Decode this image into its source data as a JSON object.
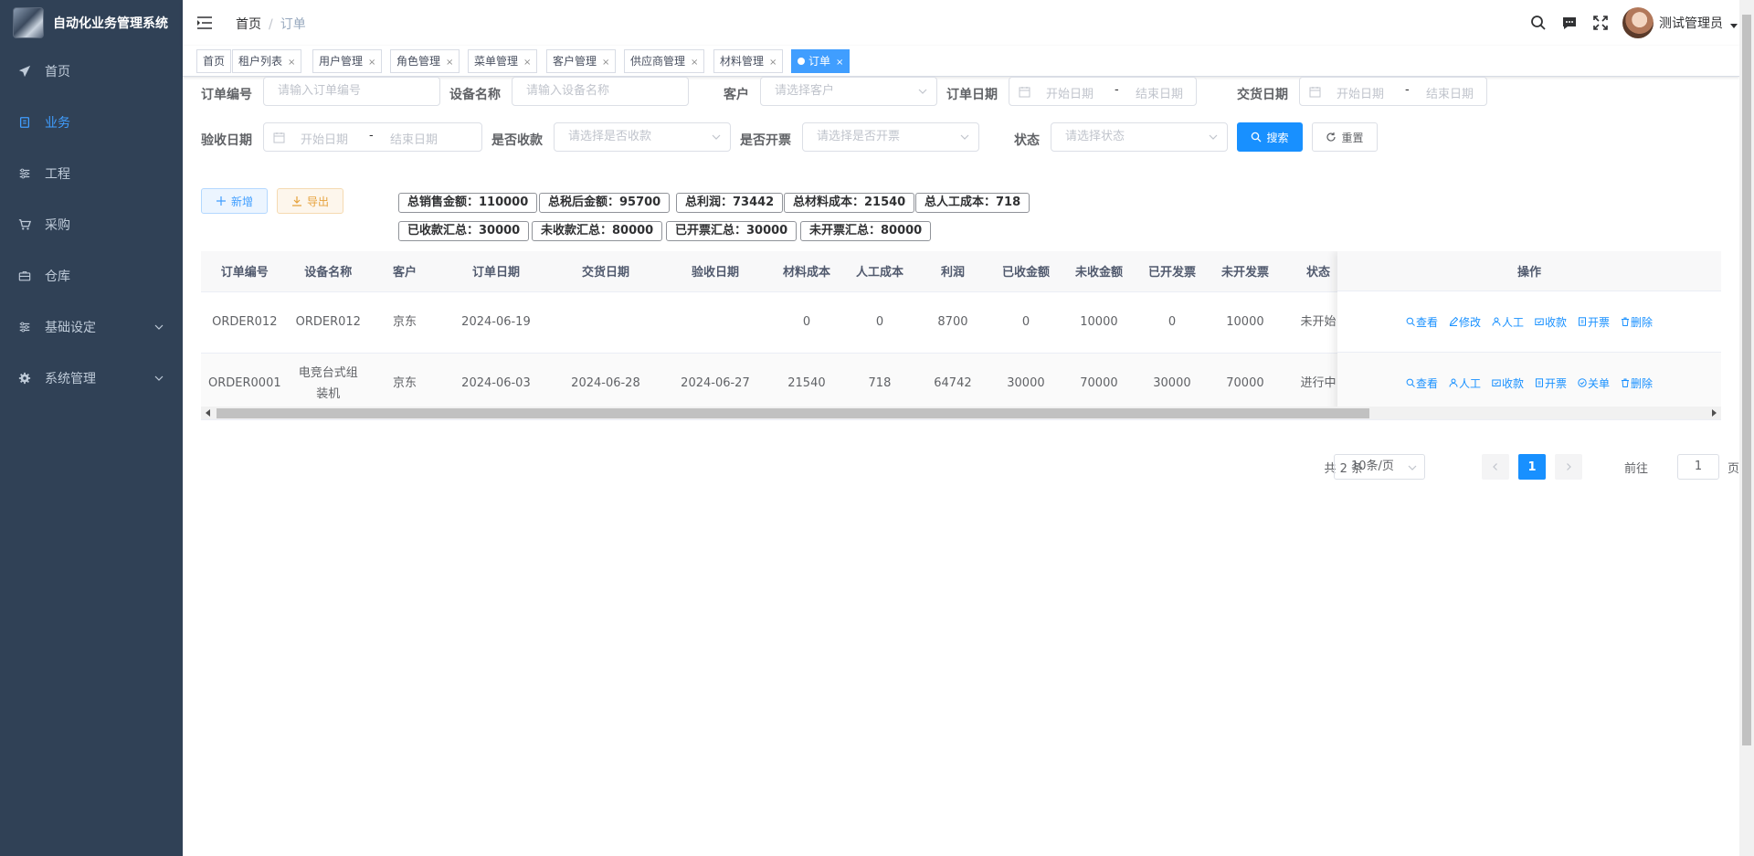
{
  "app": {
    "title": "自动化业务管理系统"
  },
  "sidebar": {
    "items": [
      {
        "label": "首页",
        "icon": "send-icon",
        "active": false
      },
      {
        "label": "业务",
        "icon": "document-icon",
        "active": true
      },
      {
        "label": "工程",
        "icon": "sliders-icon",
        "active": false
      },
      {
        "label": "采购",
        "icon": "cart-icon",
        "active": false
      },
      {
        "label": "仓库",
        "icon": "briefcase-icon",
        "active": false
      },
      {
        "label": "基础设定",
        "icon": "sliders-icon",
        "active": false,
        "expandable": true
      },
      {
        "label": "系统管理",
        "icon": "gear-icon",
        "active": false,
        "expandable": true
      }
    ]
  },
  "header": {
    "breadcrumb": {
      "home": "首页",
      "separator": "/",
      "current": "订单"
    },
    "user_name": "测试管理员"
  },
  "tabs": [
    {
      "label": "首页",
      "closable": false
    },
    {
      "label": "租户列表",
      "closable": true
    },
    {
      "label": "用户管理",
      "closable": true
    },
    {
      "label": "角色管理",
      "closable": true
    },
    {
      "label": "菜单管理",
      "closable": true
    },
    {
      "label": "客户管理",
      "closable": true
    },
    {
      "label": "供应商管理",
      "closable": true
    },
    {
      "label": "材料管理",
      "closable": true
    },
    {
      "label": "订单",
      "closable": true,
      "active": true
    }
  ],
  "filters": {
    "order_no": {
      "label": "订单编号",
      "placeholder": "请输入订单编号"
    },
    "device_name": {
      "label": "设备名称",
      "placeholder": "请输入设备名称"
    },
    "customer": {
      "label": "客户",
      "placeholder": "请选择客户"
    },
    "order_date": {
      "label": "订单日期",
      "start": "开始日期",
      "separator": "-",
      "end": "结束日期"
    },
    "delivery_date": {
      "label": "交货日期",
      "start": "开始日期",
      "separator": "-",
      "end": "结束日期"
    },
    "accept_date": {
      "label": "验收日期",
      "start": "开始日期",
      "separator": "-",
      "end": "结束日期"
    },
    "collected": {
      "label": "是否收款",
      "placeholder": "请选择是否收款"
    },
    "invoiced": {
      "label": "是否开票",
      "placeholder": "请选择是否开票"
    },
    "status": {
      "label": "状态",
      "placeholder": "请选择状态"
    },
    "search_label": "搜索",
    "reset_label": "重置"
  },
  "actions": {
    "add_label": "新增",
    "export_label": "导出"
  },
  "summary": [
    "总销售金额：110000",
    "总税后金额：95700",
    "总利润：73442",
    "总材料成本：21540",
    "总人工成本：718",
    "已收款汇总：30000",
    "未收款汇总：80000",
    "已开票汇总：30000",
    "未开票汇总：80000"
  ],
  "table": {
    "columns": [
      "订单编号",
      "设备名称",
      "客户",
      "订单日期",
      "交货日期",
      "验收日期",
      "材料成本",
      "人工成本",
      "利润",
      "已收金额",
      "未收金额",
      "已开发票",
      "未开发票",
      "状态"
    ],
    "ops_header": "操作",
    "rows": [
      {
        "cells": [
          "ORDER012",
          "ORDER012",
          "京东",
          "2024-06-19",
          "",
          "",
          "0",
          "0",
          "8700",
          "0",
          "10000",
          "0",
          "10000",
          "未开始"
        ],
        "ops": [
          "查看",
          "修改",
          "人工",
          "收款",
          "开票",
          "删除"
        ]
      },
      {
        "cells": [
          "ORDER0001",
          "电竞台式组装机",
          "京东",
          "2024-06-03",
          "2024-06-28",
          "2024-06-27",
          "21540",
          "718",
          "64742",
          "30000",
          "70000",
          "30000",
          "70000",
          "进行中"
        ],
        "ops": [
          "查看",
          "人工",
          "收款",
          "开票",
          "关单",
          "删除"
        ]
      }
    ]
  },
  "pagination": {
    "total_text": "共 2 条",
    "page_size": "10条/页",
    "current_page": "1",
    "goto_prefix": "前往",
    "goto_value": "1",
    "goto_suffix": "页"
  },
  "colors": {
    "sidebar_bg": "#304156",
    "primary": "#1890ff",
    "active_menu": "#409eff"
  }
}
